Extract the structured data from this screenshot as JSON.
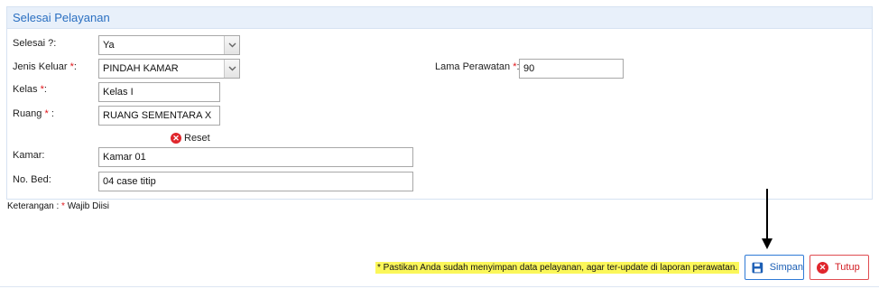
{
  "panel": {
    "title": "Selesai Pelayanan"
  },
  "form": {
    "selesai": {
      "label": "Selesai ?:",
      "value": "Ya"
    },
    "jenis_keluar": {
      "label": "Jenis Keluar ",
      "req": "*",
      "colon": ":",
      "value": "PINDAH KAMAR"
    },
    "kelas": {
      "label": "Kelas ",
      "req": "*",
      "colon": ":",
      "value": "Kelas I"
    },
    "ruang": {
      "label": "Ruang ",
      "req": "*",
      "colon": " :",
      "value": "RUANG SEMENTARA X"
    },
    "reset_label": "Reset",
    "kamar": {
      "label": "Kamar:",
      "value": "Kamar 01"
    },
    "no_bed": {
      "label": "No. Bed:",
      "value": "04 case titip"
    },
    "lama_perawatan": {
      "label": "Lama Perawatan ",
      "req": "*",
      "colon": ":",
      "value": "90"
    }
  },
  "keterangan": {
    "prefix": "Keterangan : ",
    "req": "*",
    "text": " Wajib Diisi"
  },
  "warning": "* Pastikan Anda sudah menyimpan data pelayanan, agar ter-update di laporan perawatan.",
  "buttons": {
    "save": "Simpan",
    "close": "Tutup"
  },
  "colors": {
    "accent": "#2a6fc1",
    "required": "#e0161b",
    "warning_bg": "#fbf75a",
    "close": "#d21c22"
  },
  "icons": {
    "save": "floppy-disk-icon",
    "close": "close-circle-icon",
    "reset": "close-circle-icon",
    "dropdown": "chevron-down-icon"
  }
}
